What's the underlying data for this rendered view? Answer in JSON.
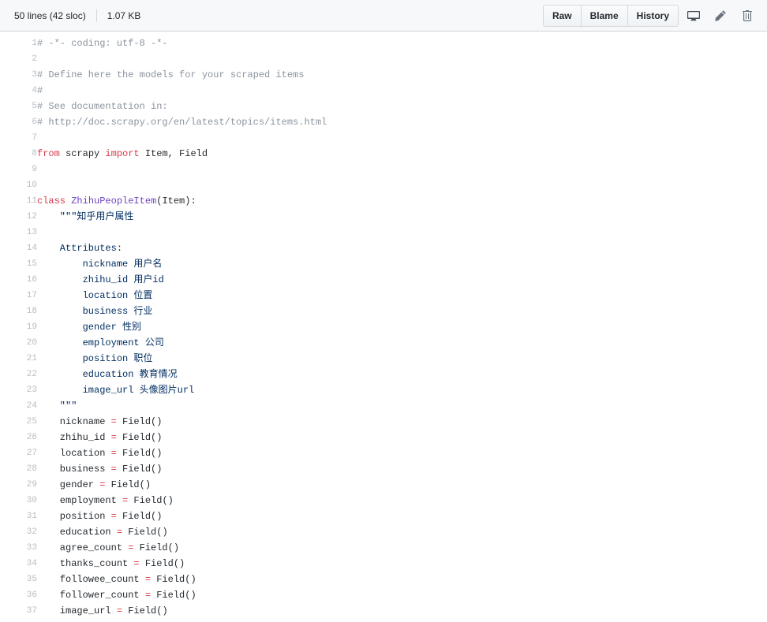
{
  "header": {
    "lines_label": "50 lines (42 sloc)",
    "file_size": "1.07 KB",
    "buttons": [
      {
        "label": "Raw",
        "name": "raw-button"
      },
      {
        "label": "Blame",
        "name": "blame-button"
      },
      {
        "label": "History",
        "name": "history-button"
      }
    ],
    "icons": [
      {
        "name": "desktop-icon",
        "title": "Open this file in GitHub Desktop"
      },
      {
        "name": "pencil-icon",
        "title": "Edit this file"
      },
      {
        "name": "trash-icon",
        "title": "Delete this file"
      }
    ]
  },
  "colors": {
    "header_bg": "#f6f8fa",
    "border": "#d1d5da",
    "comment": "#8b949e",
    "keyword": "#d73a49",
    "class_name": "#6f42c1",
    "string": "#032f62",
    "text": "#24292e",
    "line_number": "#b7bcc2"
  },
  "code": {
    "language": "Python",
    "lines": [
      {
        "num": 1,
        "tokens": [
          {
            "t": "# -*- coding: utf-8 -*-",
            "c": "c"
          }
        ]
      },
      {
        "num": 2,
        "tokens": []
      },
      {
        "num": 3,
        "tokens": [
          {
            "t": "# Define here the models for your scraped items",
            "c": "c"
          }
        ]
      },
      {
        "num": 4,
        "tokens": [
          {
            "t": "#",
            "c": "c"
          }
        ]
      },
      {
        "num": 5,
        "tokens": [
          {
            "t": "# See documentation in:",
            "c": "c"
          }
        ]
      },
      {
        "num": 6,
        "tokens": [
          {
            "t": "# http://doc.scrapy.org/en/latest/topics/items.html",
            "c": "c"
          }
        ]
      },
      {
        "num": 7,
        "tokens": []
      },
      {
        "num": 8,
        "tokens": [
          {
            "t": "from",
            "c": "k"
          },
          {
            "t": " scrapy ",
            "c": "n"
          },
          {
            "t": "import",
            "c": "k"
          },
          {
            "t": " Item, Field",
            "c": "n"
          }
        ]
      },
      {
        "num": 9,
        "tokens": []
      },
      {
        "num": 10,
        "tokens": []
      },
      {
        "num": 11,
        "tokens": [
          {
            "t": "class",
            "c": "k"
          },
          {
            "t": " ",
            "c": "n"
          },
          {
            "t": "ZhihuPeopleItem",
            "c": "nc"
          },
          {
            "t": "(Item):",
            "c": "n"
          }
        ]
      },
      {
        "num": 12,
        "tokens": [
          {
            "t": "    \"\"\"知乎用户属性",
            "c": "s"
          }
        ]
      },
      {
        "num": 13,
        "tokens": []
      },
      {
        "num": 14,
        "tokens": [
          {
            "t": "    Attributes:",
            "c": "s"
          }
        ]
      },
      {
        "num": 15,
        "tokens": [
          {
            "t": "        nickname 用户名",
            "c": "s"
          }
        ]
      },
      {
        "num": 16,
        "tokens": [
          {
            "t": "        zhihu_id 用户id",
            "c": "s"
          }
        ]
      },
      {
        "num": 17,
        "tokens": [
          {
            "t": "        location 位置",
            "c": "s"
          }
        ]
      },
      {
        "num": 18,
        "tokens": [
          {
            "t": "        business 行业",
            "c": "s"
          }
        ]
      },
      {
        "num": 19,
        "tokens": [
          {
            "t": "        gender 性别",
            "c": "s"
          }
        ]
      },
      {
        "num": 20,
        "tokens": [
          {
            "t": "        employment 公司",
            "c": "s"
          }
        ]
      },
      {
        "num": 21,
        "tokens": [
          {
            "t": "        position 职位",
            "c": "s"
          }
        ]
      },
      {
        "num": 22,
        "tokens": [
          {
            "t": "        education 教育情况",
            "c": "s"
          }
        ]
      },
      {
        "num": 23,
        "tokens": [
          {
            "t": "        image_url 头像图片url",
            "c": "s"
          }
        ]
      },
      {
        "num": 24,
        "tokens": [
          {
            "t": "    \"\"\"",
            "c": "s"
          }
        ]
      },
      {
        "num": 25,
        "tokens": [
          {
            "t": "    nickname ",
            "c": "n"
          },
          {
            "t": "=",
            "c": "o"
          },
          {
            "t": " Field()",
            "c": "n"
          }
        ]
      },
      {
        "num": 26,
        "tokens": [
          {
            "t": "    zhihu_id ",
            "c": "n"
          },
          {
            "t": "=",
            "c": "o"
          },
          {
            "t": " Field()",
            "c": "n"
          }
        ]
      },
      {
        "num": 27,
        "tokens": [
          {
            "t": "    location ",
            "c": "n"
          },
          {
            "t": "=",
            "c": "o"
          },
          {
            "t": " Field()",
            "c": "n"
          }
        ]
      },
      {
        "num": 28,
        "tokens": [
          {
            "t": "    business ",
            "c": "n"
          },
          {
            "t": "=",
            "c": "o"
          },
          {
            "t": " Field()",
            "c": "n"
          }
        ]
      },
      {
        "num": 29,
        "tokens": [
          {
            "t": "    gender ",
            "c": "n"
          },
          {
            "t": "=",
            "c": "o"
          },
          {
            "t": " Field()",
            "c": "n"
          }
        ]
      },
      {
        "num": 30,
        "tokens": [
          {
            "t": "    employment ",
            "c": "n"
          },
          {
            "t": "=",
            "c": "o"
          },
          {
            "t": " Field()",
            "c": "n"
          }
        ]
      },
      {
        "num": 31,
        "tokens": [
          {
            "t": "    position ",
            "c": "n"
          },
          {
            "t": "=",
            "c": "o"
          },
          {
            "t": " Field()",
            "c": "n"
          }
        ]
      },
      {
        "num": 32,
        "tokens": [
          {
            "t": "    education ",
            "c": "n"
          },
          {
            "t": "=",
            "c": "o"
          },
          {
            "t": " Field()",
            "c": "n"
          }
        ]
      },
      {
        "num": 33,
        "tokens": [
          {
            "t": "    agree_count ",
            "c": "n"
          },
          {
            "t": "=",
            "c": "o"
          },
          {
            "t": " Field()",
            "c": "n"
          }
        ]
      },
      {
        "num": 34,
        "tokens": [
          {
            "t": "    thanks_count ",
            "c": "n"
          },
          {
            "t": "=",
            "c": "o"
          },
          {
            "t": " Field()",
            "c": "n"
          }
        ]
      },
      {
        "num": 35,
        "tokens": [
          {
            "t": "    followee_count ",
            "c": "n"
          },
          {
            "t": "=",
            "c": "o"
          },
          {
            "t": " Field()",
            "c": "n"
          }
        ]
      },
      {
        "num": 36,
        "tokens": [
          {
            "t": "    follower_count ",
            "c": "n"
          },
          {
            "t": "=",
            "c": "o"
          },
          {
            "t": " Field()",
            "c": "n"
          }
        ]
      },
      {
        "num": 37,
        "tokens": [
          {
            "t": "    image_url ",
            "c": "n"
          },
          {
            "t": "=",
            "c": "o"
          },
          {
            "t": " Field()",
            "c": "n"
          }
        ]
      }
    ]
  }
}
